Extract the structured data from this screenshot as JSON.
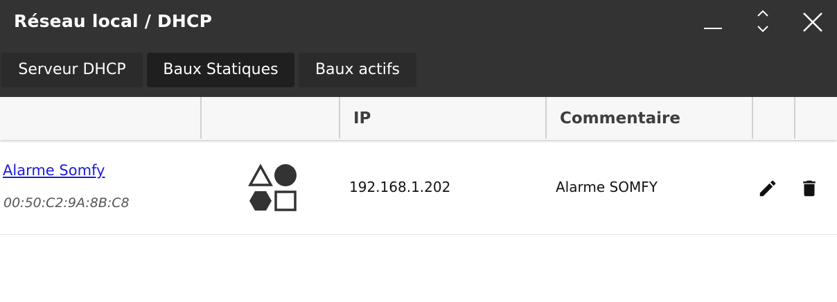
{
  "window": {
    "title": "Réseau local / DHCP",
    "controls": [
      "minimize-icon",
      "expand-collapse-icon",
      "close-icon"
    ]
  },
  "tabs": [
    {
      "label": "Serveur DHCP",
      "active": false
    },
    {
      "label": "Baux Statiques",
      "active": true
    },
    {
      "label": "Baux actifs",
      "active": false
    }
  ],
  "table": {
    "columns": [
      "",
      "",
      "IP",
      "Commentaire",
      "",
      ""
    ],
    "rows": [
      {
        "name": "Alarme Somfy",
        "mac": "00:50:C2:9A:8B:C8",
        "icon": "device-type-shapes-icon",
        "ip": "192.168.1.202",
        "comment": "Alarme SOMFY",
        "actions": [
          "edit-icon",
          "delete-icon"
        ]
      }
    ]
  },
  "colors": {
    "titlebar": "#333333",
    "tab": "#2b2b2b",
    "tab_active": "#1f1f1f",
    "header_bg": "#f7f7f7",
    "link": "#1a1add"
  }
}
